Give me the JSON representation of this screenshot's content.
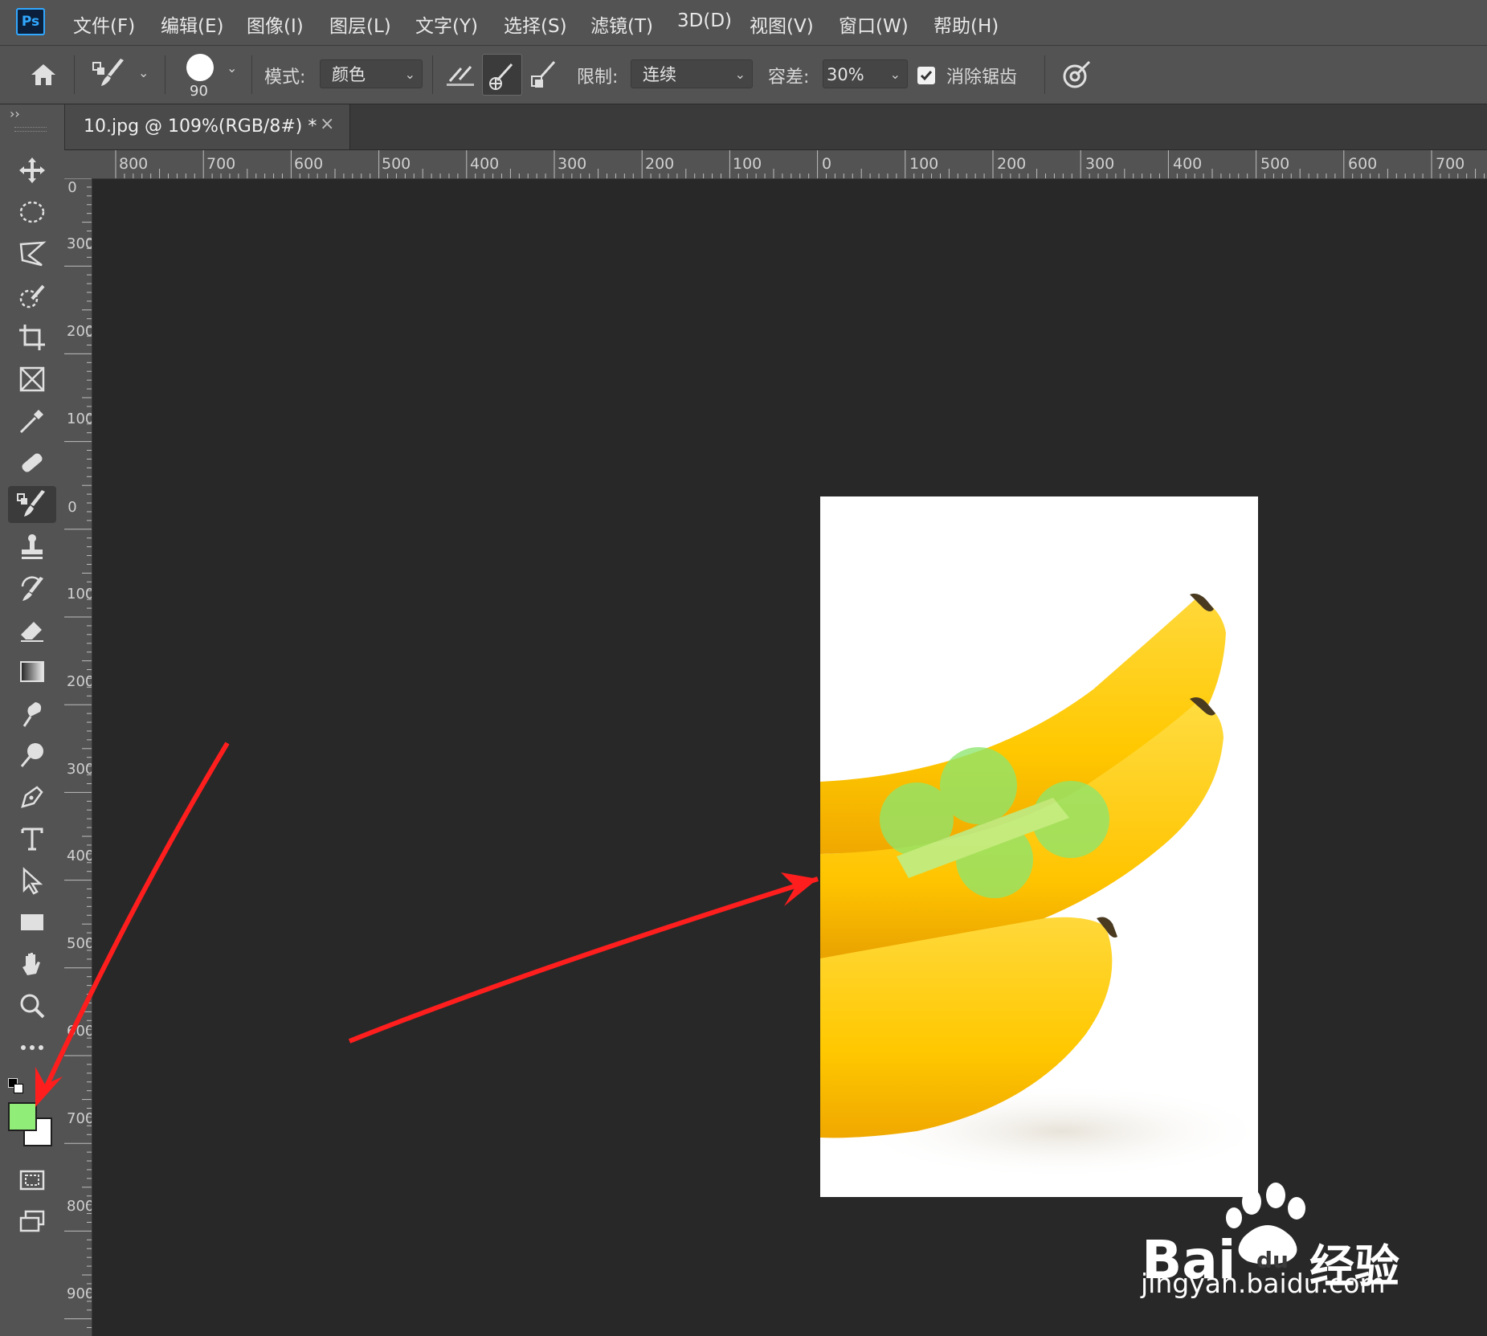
{
  "app": {
    "logo_text": "Ps"
  },
  "menu": [
    {
      "label": "文件(F)"
    },
    {
      "label": "编辑(E)"
    },
    {
      "label": "图像(I)"
    },
    {
      "label": "图层(L)"
    },
    {
      "label": "文字(Y)"
    },
    {
      "label": "选择(S)"
    },
    {
      "label": "滤镜(T)"
    },
    {
      "label": "3D(D)"
    },
    {
      "label": "视图(V)"
    },
    {
      "label": "窗口(W)"
    },
    {
      "label": "帮助(H)"
    }
  ],
  "options": {
    "brush_size": "90",
    "mode_label": "模式:",
    "mode_value": "颜色",
    "limit_label": "限制:",
    "limit_value": "连续",
    "tolerance_label": "容差:",
    "tolerance_value": "30%",
    "antialias_label": "消除锯齿",
    "antialias_checked": true
  },
  "document": {
    "tab_title": "10.jpg @ 109%(RGB/8#) *",
    "close_glyph": "×"
  },
  "rulers": {
    "horizontal": [
      "800",
      "700",
      "600",
      "500",
      "400",
      "300",
      "200",
      "100",
      "0",
      "100",
      "200",
      "300",
      "400",
      "500",
      "600",
      "700"
    ],
    "vertical": [
      "0",
      "300",
      "200",
      "100",
      "0",
      "100",
      "200",
      "300",
      "400",
      "500",
      "600",
      "700",
      "800",
      "900"
    ]
  },
  "tools": [
    "move-tool-icon",
    "elliptical-marquee-icon",
    "lasso-icon",
    "quick-selection-icon",
    "crop-icon",
    "frame-icon",
    "eyedropper-icon",
    "healing-brush-icon",
    "color-replacement-brush-icon",
    "clone-stamp-icon",
    "history-brush-icon",
    "eraser-icon",
    "gradient-icon",
    "smudge-icon",
    "dodge-icon",
    "pen-icon",
    "type-icon",
    "path-selection-icon",
    "rectangle-icon",
    "hand-icon",
    "zoom-icon",
    "more-tools-icon"
  ],
  "colors": {
    "foreground": "#90ee78",
    "background": "#ffffff",
    "annotation_arrow": "#ff1e1e"
  },
  "watermark": {
    "brand": "Bai",
    "brand_paw_glyph": "du",
    "suffix": "经验",
    "domain": "jingyan.baidu.com"
  }
}
